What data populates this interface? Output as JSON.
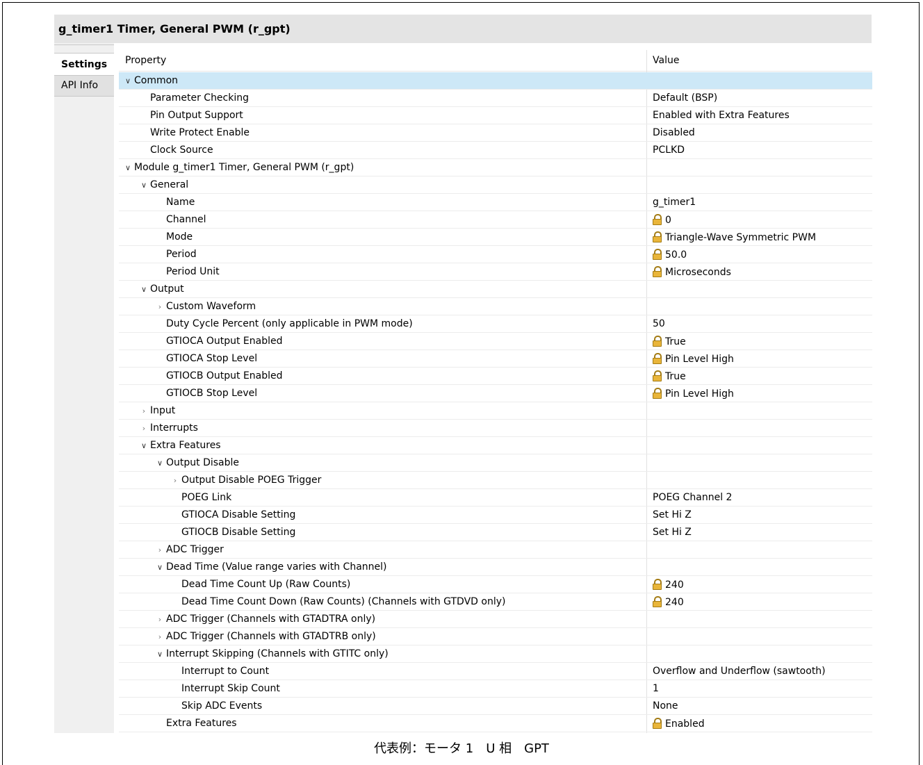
{
  "window": {
    "title": "g_timer1 Timer, General PWM (r_gpt)"
  },
  "tabs": [
    {
      "label": "Settings"
    },
    {
      "label": "API Info"
    }
  ],
  "grid": {
    "columns": {
      "property": "Property",
      "value": "Value"
    },
    "rows": [
      {
        "label": "Common",
        "value": "",
        "level": 0,
        "expander": "open",
        "locked": false,
        "selected": true
      },
      {
        "label": "Parameter Checking",
        "value": "Default (BSP)",
        "level": 1,
        "expander": "none",
        "locked": false
      },
      {
        "label": "Pin Output Support",
        "value": "Enabled with Extra Features",
        "level": 1,
        "expander": "none",
        "locked": false
      },
      {
        "label": "Write Protect Enable",
        "value": "Disabled",
        "level": 1,
        "expander": "none",
        "locked": false
      },
      {
        "label": "Clock Source",
        "value": "PCLKD",
        "level": 1,
        "expander": "none",
        "locked": false
      },
      {
        "label": "Module g_timer1 Timer, General PWM (r_gpt)",
        "value": "",
        "level": 0,
        "expander": "open",
        "locked": false
      },
      {
        "label": "General",
        "value": "",
        "level": 1,
        "expander": "open",
        "locked": false
      },
      {
        "label": "Name",
        "value": "g_timer1",
        "level": 2,
        "expander": "none",
        "locked": false
      },
      {
        "label": "Channel",
        "value": "0",
        "level": 2,
        "expander": "none",
        "locked": true
      },
      {
        "label": "Mode",
        "value": "Triangle-Wave Symmetric PWM",
        "level": 2,
        "expander": "none",
        "locked": true
      },
      {
        "label": "Period",
        "value": "50.0",
        "level": 2,
        "expander": "none",
        "locked": true
      },
      {
        "label": "Period Unit",
        "value": "Microseconds",
        "level": 2,
        "expander": "none",
        "locked": true
      },
      {
        "label": "Output",
        "value": "",
        "level": 1,
        "expander": "open",
        "locked": false
      },
      {
        "label": "Custom Waveform",
        "value": "",
        "level": 2,
        "expander": "closed",
        "locked": false
      },
      {
        "label": "Duty Cycle Percent (only applicable in PWM mode)",
        "value": "50",
        "level": 2,
        "expander": "none",
        "locked": false
      },
      {
        "label": "GTIOCA Output Enabled",
        "value": "True",
        "level": 2,
        "expander": "none",
        "locked": true
      },
      {
        "label": "GTIOCA Stop Level",
        "value": "Pin Level High",
        "level": 2,
        "expander": "none",
        "locked": true
      },
      {
        "label": "GTIOCB Output Enabled",
        "value": "True",
        "level": 2,
        "expander": "none",
        "locked": true
      },
      {
        "label": "GTIOCB Stop Level",
        "value": "Pin Level High",
        "level": 2,
        "expander": "none",
        "locked": true
      },
      {
        "label": "Input",
        "value": "",
        "level": 1,
        "expander": "closed",
        "locked": false
      },
      {
        "label": "Interrupts",
        "value": "",
        "level": 1,
        "expander": "closed",
        "locked": false
      },
      {
        "label": "Extra Features",
        "value": "",
        "level": 1,
        "expander": "open",
        "locked": false
      },
      {
        "label": "Output Disable",
        "value": "",
        "level": 2,
        "expander": "open",
        "locked": false
      },
      {
        "label": "Output Disable POEG Trigger",
        "value": "",
        "level": 3,
        "expander": "closed",
        "locked": false
      },
      {
        "label": "POEG Link",
        "value": "POEG Channel 2",
        "level": 3,
        "expander": "none",
        "locked": false
      },
      {
        "label": "GTIOCA Disable Setting",
        "value": "Set Hi Z",
        "level": 3,
        "expander": "none",
        "locked": false
      },
      {
        "label": "GTIOCB Disable Setting",
        "value": "Set Hi Z",
        "level": 3,
        "expander": "none",
        "locked": false
      },
      {
        "label": "ADC Trigger",
        "value": "",
        "level": 2,
        "expander": "closed",
        "locked": false
      },
      {
        "label": "Dead Time (Value range varies with Channel)",
        "value": "",
        "level": 2,
        "expander": "open",
        "locked": false
      },
      {
        "label": "Dead Time Count Up (Raw Counts)",
        "value": "240",
        "level": 3,
        "expander": "none",
        "locked": true
      },
      {
        "label": "Dead Time Count Down (Raw Counts) (Channels with GTDVD only)",
        "value": "240",
        "level": 3,
        "expander": "none",
        "locked": true
      },
      {
        "label": "ADC Trigger (Channels with GTADTRA only)",
        "value": "",
        "level": 2,
        "expander": "closed",
        "locked": false
      },
      {
        "label": "ADC Trigger (Channels with GTADTRB only)",
        "value": "",
        "level": 2,
        "expander": "closed",
        "locked": false
      },
      {
        "label": "Interrupt Skipping (Channels with GTITC only)",
        "value": "",
        "level": 2,
        "expander": "open",
        "locked": false
      },
      {
        "label": "Interrupt to Count",
        "value": "Overflow and Underflow (sawtooth)",
        "level": 3,
        "expander": "none",
        "locked": false
      },
      {
        "label": "Interrupt Skip Count",
        "value": "1",
        "level": 3,
        "expander": "none",
        "locked": false
      },
      {
        "label": "Skip ADC Events",
        "value": "None",
        "level": 3,
        "expander": "none",
        "locked": false
      },
      {
        "label": "Extra Features",
        "value": "Enabled",
        "level": 2,
        "expander": "none",
        "locked": true
      }
    ]
  },
  "caption": "代表例：モータ 1　U 相　GPT"
}
